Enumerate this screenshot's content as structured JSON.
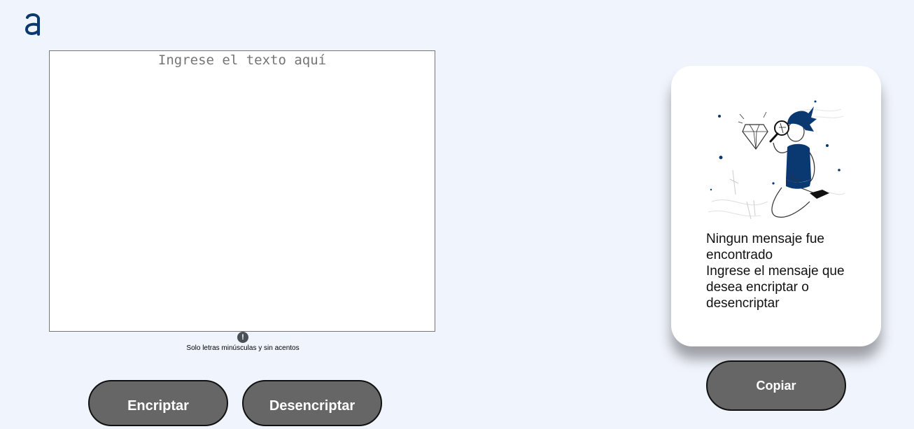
{
  "app": {
    "logo_icon": "alura-a-logo",
    "brand_color": "#0a3871"
  },
  "editor": {
    "placeholder": "Ingrese el texto aquí"
  },
  "hint": {
    "icon": "exclamation-icon",
    "text": "Solo letras minúsculas y sin acentos"
  },
  "actions": {
    "encrypt_label": "Encriptar",
    "decrypt_label": "Desencriptar",
    "copy_label": "Copiar",
    "button_color": "#666666"
  },
  "output": {
    "illustration_icon": "person-with-magnifier-illustration",
    "title": "Ningun mensaje fue encontrado",
    "body": "Ingrese el mensaje que desea encriptar o desencriptar"
  }
}
